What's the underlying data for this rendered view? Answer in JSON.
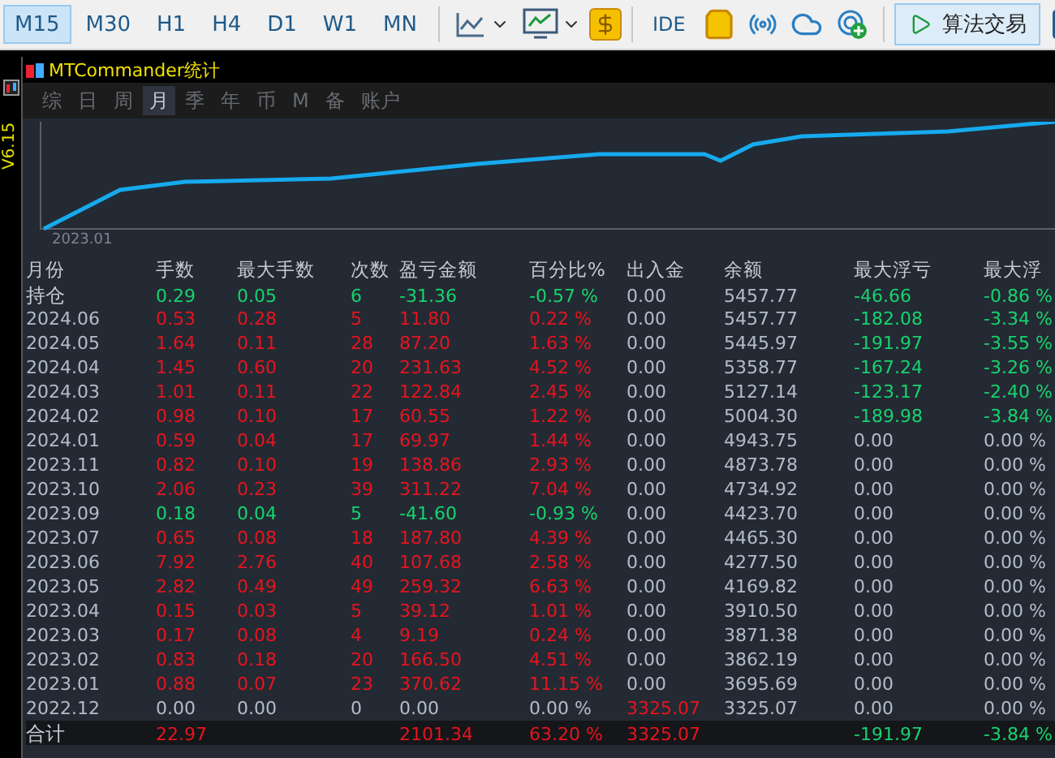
{
  "toolbar": {
    "timeframes": [
      {
        "label": "M15",
        "selected": true
      },
      {
        "label": "M30",
        "selected": false
      },
      {
        "label": "H1",
        "selected": false
      },
      {
        "label": "H4",
        "selected": false
      },
      {
        "label": "D1",
        "selected": false
      },
      {
        "label": "W1",
        "selected": false
      },
      {
        "label": "MN",
        "selected": false
      }
    ],
    "ide_label": "IDE",
    "algo_button": {
      "label": "算法交易",
      "selected": true
    }
  },
  "side_label": "V6.15",
  "panel": {
    "title": "MTCommander统计",
    "tabs": [
      {
        "label": "综",
        "selected": false
      },
      {
        "label": "日",
        "selected": false
      },
      {
        "label": "周",
        "selected": false
      },
      {
        "label": "月",
        "selected": true
      },
      {
        "label": "季",
        "selected": false
      },
      {
        "label": "年",
        "selected": false
      },
      {
        "label": "币",
        "selected": false
      },
      {
        "label": "M",
        "selected": false
      },
      {
        "label": "备",
        "selected": false
      },
      {
        "label": "账户",
        "selected": false
      }
    ],
    "chart_label": "2023.01",
    "table": {
      "columns": [
        "月份",
        "手数",
        "最大手数",
        "次数",
        "盈亏金额",
        "百分比%",
        "出入金",
        "余额",
        "最大浮亏",
        "最大浮"
      ],
      "rows": [
        {
          "kind": "open",
          "cells": [
            {
              "text": "持仓",
              "color": "#c5cad1"
            },
            {
              "text": "0.29",
              "color": "#18d26e"
            },
            {
              "text": "0.05",
              "color": "#18d26e"
            },
            {
              "text": "6",
              "color": "#18d26e"
            },
            {
              "text": "-31.36",
              "color": "#18d26e"
            },
            {
              "text": "-0.57 %",
              "color": "#18d26e"
            },
            {
              "text": "0.00",
              "color": "#b4bcc8"
            },
            {
              "text": "5457.77",
              "color": "#b4bcc8"
            },
            {
              "text": "-46.66",
              "color": "#18d26e"
            },
            {
              "text": "-0.86 %",
              "color": "#18d26e"
            }
          ]
        },
        {
          "kind": "month",
          "cells": [
            {
              "text": "2024.06",
              "color": "#b4bcc8"
            },
            {
              "text": "0.53",
              "color": "#e8141e"
            },
            {
              "text": "0.28",
              "color": "#e8141e"
            },
            {
              "text": "5",
              "color": "#e8141e"
            },
            {
              "text": "11.80",
              "color": "#e8141e"
            },
            {
              "text": "0.22 %",
              "color": "#e8141e"
            },
            {
              "text": "0.00",
              "color": "#b4bcc8"
            },
            {
              "text": "5457.77",
              "color": "#b4bcc8"
            },
            {
              "text": "-182.08",
              "color": "#18d26e"
            },
            {
              "text": "-3.34 %",
              "color": "#18d26e"
            }
          ]
        },
        {
          "kind": "month",
          "cells": [
            {
              "text": "2024.05",
              "color": "#b4bcc8"
            },
            {
              "text": "1.64",
              "color": "#e8141e"
            },
            {
              "text": "0.11",
              "color": "#e8141e"
            },
            {
              "text": "28",
              "color": "#e8141e"
            },
            {
              "text": "87.20",
              "color": "#e8141e"
            },
            {
              "text": "1.63 %",
              "color": "#e8141e"
            },
            {
              "text": "0.00",
              "color": "#b4bcc8"
            },
            {
              "text": "5445.97",
              "color": "#b4bcc8"
            },
            {
              "text": "-191.97",
              "color": "#18d26e"
            },
            {
              "text": "-3.55 %",
              "color": "#18d26e"
            }
          ]
        },
        {
          "kind": "month",
          "cells": [
            {
              "text": "2024.04",
              "color": "#b4bcc8"
            },
            {
              "text": "1.45",
              "color": "#e8141e"
            },
            {
              "text": "0.60",
              "color": "#e8141e"
            },
            {
              "text": "20",
              "color": "#e8141e"
            },
            {
              "text": "231.63",
              "color": "#e8141e"
            },
            {
              "text": "4.52 %",
              "color": "#e8141e"
            },
            {
              "text": "0.00",
              "color": "#b4bcc8"
            },
            {
              "text": "5358.77",
              "color": "#b4bcc8"
            },
            {
              "text": "-167.24",
              "color": "#18d26e"
            },
            {
              "text": "-3.26 %",
              "color": "#18d26e"
            }
          ]
        },
        {
          "kind": "month",
          "cells": [
            {
              "text": "2024.03",
              "color": "#b4bcc8"
            },
            {
              "text": "1.01",
              "color": "#e8141e"
            },
            {
              "text": "0.11",
              "color": "#e8141e"
            },
            {
              "text": "22",
              "color": "#e8141e"
            },
            {
              "text": "122.84",
              "color": "#e8141e"
            },
            {
              "text": "2.45 %",
              "color": "#e8141e"
            },
            {
              "text": "0.00",
              "color": "#b4bcc8"
            },
            {
              "text": "5127.14",
              "color": "#b4bcc8"
            },
            {
              "text": "-123.17",
              "color": "#18d26e"
            },
            {
              "text": "-2.40 %",
              "color": "#18d26e"
            }
          ]
        },
        {
          "kind": "month",
          "cells": [
            {
              "text": "2024.02",
              "color": "#b4bcc8"
            },
            {
              "text": "0.98",
              "color": "#e8141e"
            },
            {
              "text": "0.10",
              "color": "#e8141e"
            },
            {
              "text": "17",
              "color": "#e8141e"
            },
            {
              "text": "60.55",
              "color": "#e8141e"
            },
            {
              "text": "1.22 %",
              "color": "#e8141e"
            },
            {
              "text": "0.00",
              "color": "#b4bcc8"
            },
            {
              "text": "5004.30",
              "color": "#b4bcc8"
            },
            {
              "text": "-189.98",
              "color": "#18d26e"
            },
            {
              "text": "-3.84 %",
              "color": "#18d26e"
            }
          ]
        },
        {
          "kind": "month",
          "cells": [
            {
              "text": "2024.01",
              "color": "#b4bcc8"
            },
            {
              "text": "0.59",
              "color": "#e8141e"
            },
            {
              "text": "0.04",
              "color": "#e8141e"
            },
            {
              "text": "17",
              "color": "#e8141e"
            },
            {
              "text": "69.97",
              "color": "#e8141e"
            },
            {
              "text": "1.44 %",
              "color": "#e8141e"
            },
            {
              "text": "0.00",
              "color": "#b4bcc8"
            },
            {
              "text": "4943.75",
              "color": "#b4bcc8"
            },
            {
              "text": "0.00",
              "color": "#b4bcc8"
            },
            {
              "text": "0.00 %",
              "color": "#b4bcc8"
            }
          ]
        },
        {
          "kind": "month",
          "cells": [
            {
              "text": "2023.11",
              "color": "#b4bcc8"
            },
            {
              "text": "0.82",
              "color": "#e8141e"
            },
            {
              "text": "0.10",
              "color": "#e8141e"
            },
            {
              "text": "19",
              "color": "#e8141e"
            },
            {
              "text": "138.86",
              "color": "#e8141e"
            },
            {
              "text": "2.93 %",
              "color": "#e8141e"
            },
            {
              "text": "0.00",
              "color": "#b4bcc8"
            },
            {
              "text": "4873.78",
              "color": "#b4bcc8"
            },
            {
              "text": "0.00",
              "color": "#b4bcc8"
            },
            {
              "text": "0.00 %",
              "color": "#b4bcc8"
            }
          ]
        },
        {
          "kind": "month",
          "cells": [
            {
              "text": "2023.10",
              "color": "#b4bcc8"
            },
            {
              "text": "2.06",
              "color": "#e8141e"
            },
            {
              "text": "0.23",
              "color": "#e8141e"
            },
            {
              "text": "39",
              "color": "#e8141e"
            },
            {
              "text": "311.22",
              "color": "#e8141e"
            },
            {
              "text": "7.04 %",
              "color": "#e8141e"
            },
            {
              "text": "0.00",
              "color": "#b4bcc8"
            },
            {
              "text": "4734.92",
              "color": "#b4bcc8"
            },
            {
              "text": "0.00",
              "color": "#b4bcc8"
            },
            {
              "text": "0.00 %",
              "color": "#b4bcc8"
            }
          ]
        },
        {
          "kind": "month",
          "cells": [
            {
              "text": "2023.09",
              "color": "#b4bcc8"
            },
            {
              "text": "0.18",
              "color": "#18d26e"
            },
            {
              "text": "0.04",
              "color": "#18d26e"
            },
            {
              "text": "5",
              "color": "#18d26e"
            },
            {
              "text": "-41.60",
              "color": "#18d26e"
            },
            {
              "text": "-0.93 %",
              "color": "#18d26e"
            },
            {
              "text": "0.00",
              "color": "#b4bcc8"
            },
            {
              "text": "4423.70",
              "color": "#b4bcc8"
            },
            {
              "text": "0.00",
              "color": "#b4bcc8"
            },
            {
              "text": "0.00 %",
              "color": "#b4bcc8"
            }
          ]
        },
        {
          "kind": "month",
          "cells": [
            {
              "text": "2023.07",
              "color": "#b4bcc8"
            },
            {
              "text": "0.65",
              "color": "#e8141e"
            },
            {
              "text": "0.08",
              "color": "#e8141e"
            },
            {
              "text": "18",
              "color": "#e8141e"
            },
            {
              "text": "187.80",
              "color": "#e8141e"
            },
            {
              "text": "4.39 %",
              "color": "#e8141e"
            },
            {
              "text": "0.00",
              "color": "#b4bcc8"
            },
            {
              "text": "4465.30",
              "color": "#b4bcc8"
            },
            {
              "text": "0.00",
              "color": "#b4bcc8"
            },
            {
              "text": "0.00 %",
              "color": "#b4bcc8"
            }
          ]
        },
        {
          "kind": "month",
          "cells": [
            {
              "text": "2023.06",
              "color": "#b4bcc8"
            },
            {
              "text": "7.92",
              "color": "#e8141e"
            },
            {
              "text": "2.76",
              "color": "#e8141e"
            },
            {
              "text": "40",
              "color": "#e8141e"
            },
            {
              "text": "107.68",
              "color": "#e8141e"
            },
            {
              "text": "2.58 %",
              "color": "#e8141e"
            },
            {
              "text": "0.00",
              "color": "#b4bcc8"
            },
            {
              "text": "4277.50",
              "color": "#b4bcc8"
            },
            {
              "text": "0.00",
              "color": "#b4bcc8"
            },
            {
              "text": "0.00 %",
              "color": "#b4bcc8"
            }
          ]
        },
        {
          "kind": "month",
          "cells": [
            {
              "text": "2023.05",
              "color": "#b4bcc8"
            },
            {
              "text": "2.82",
              "color": "#e8141e"
            },
            {
              "text": "0.49",
              "color": "#e8141e"
            },
            {
              "text": "49",
              "color": "#e8141e"
            },
            {
              "text": "259.32",
              "color": "#e8141e"
            },
            {
              "text": "6.63 %",
              "color": "#e8141e"
            },
            {
              "text": "0.00",
              "color": "#b4bcc8"
            },
            {
              "text": "4169.82",
              "color": "#b4bcc8"
            },
            {
              "text": "0.00",
              "color": "#b4bcc8"
            },
            {
              "text": "0.00 %",
              "color": "#b4bcc8"
            }
          ]
        },
        {
          "kind": "month",
          "cells": [
            {
              "text": "2023.04",
              "color": "#b4bcc8"
            },
            {
              "text": "0.15",
              "color": "#e8141e"
            },
            {
              "text": "0.03",
              "color": "#e8141e"
            },
            {
              "text": "5",
              "color": "#e8141e"
            },
            {
              "text": "39.12",
              "color": "#e8141e"
            },
            {
              "text": "1.01 %",
              "color": "#e8141e"
            },
            {
              "text": "0.00",
              "color": "#b4bcc8"
            },
            {
              "text": "3910.50",
              "color": "#b4bcc8"
            },
            {
              "text": "0.00",
              "color": "#b4bcc8"
            },
            {
              "text": "0.00 %",
              "color": "#b4bcc8"
            }
          ]
        },
        {
          "kind": "month",
          "cells": [
            {
              "text": "2023.03",
              "color": "#b4bcc8"
            },
            {
              "text": "0.17",
              "color": "#e8141e"
            },
            {
              "text": "0.08",
              "color": "#e8141e"
            },
            {
              "text": "4",
              "color": "#e8141e"
            },
            {
              "text": "9.19",
              "color": "#e8141e"
            },
            {
              "text": "0.24 %",
              "color": "#e8141e"
            },
            {
              "text": "0.00",
              "color": "#b4bcc8"
            },
            {
              "text": "3871.38",
              "color": "#b4bcc8"
            },
            {
              "text": "0.00",
              "color": "#b4bcc8"
            },
            {
              "text": "0.00 %",
              "color": "#b4bcc8"
            }
          ]
        },
        {
          "kind": "month",
          "cells": [
            {
              "text": "2023.02",
              "color": "#b4bcc8"
            },
            {
              "text": "0.83",
              "color": "#e8141e"
            },
            {
              "text": "0.18",
              "color": "#e8141e"
            },
            {
              "text": "20",
              "color": "#e8141e"
            },
            {
              "text": "166.50",
              "color": "#e8141e"
            },
            {
              "text": "4.51 %",
              "color": "#e8141e"
            },
            {
              "text": "0.00",
              "color": "#b4bcc8"
            },
            {
              "text": "3862.19",
              "color": "#b4bcc8"
            },
            {
              "text": "0.00",
              "color": "#b4bcc8"
            },
            {
              "text": "0.00 %",
              "color": "#b4bcc8"
            }
          ]
        },
        {
          "kind": "month",
          "cells": [
            {
              "text": "2023.01",
              "color": "#b4bcc8"
            },
            {
              "text": "0.88",
              "color": "#e8141e"
            },
            {
              "text": "0.07",
              "color": "#e8141e"
            },
            {
              "text": "23",
              "color": "#e8141e"
            },
            {
              "text": "370.62",
              "color": "#e8141e"
            },
            {
              "text": "11.15 %",
              "color": "#e8141e"
            },
            {
              "text": "0.00",
              "color": "#b4bcc8"
            },
            {
              "text": "3695.69",
              "color": "#b4bcc8"
            },
            {
              "text": "0.00",
              "color": "#b4bcc8"
            },
            {
              "text": "0.00 %",
              "color": "#b4bcc8"
            }
          ]
        },
        {
          "kind": "month",
          "cells": [
            {
              "text": "2022.12",
              "color": "#b4bcc8"
            },
            {
              "text": "0.00",
              "color": "#b4bcc8"
            },
            {
              "text": "0.00",
              "color": "#b4bcc8"
            },
            {
              "text": "0",
              "color": "#b4bcc8"
            },
            {
              "text": "0.00",
              "color": "#b4bcc8"
            },
            {
              "text": "0.00 %",
              "color": "#b4bcc8"
            },
            {
              "text": "3325.07",
              "color": "#e8141e"
            },
            {
              "text": "3325.07",
              "color": "#b4bcc8"
            },
            {
              "text": "0.00",
              "color": "#b4bcc8"
            },
            {
              "text": "0.00 %",
              "color": "#b4bcc8"
            }
          ]
        },
        {
          "kind": "total",
          "cells": [
            {
              "text": "合计",
              "color": "#c5cad1"
            },
            {
              "text": "22.97",
              "color": "#e8141e"
            },
            {
              "text": ""
            },
            {
              "text": ""
            },
            {
              "text": "2101.34",
              "color": "#e8141e"
            },
            {
              "text": "63.20 %",
              "color": "#e8141e"
            },
            {
              "text": "3325.07",
              "color": "#e8141e"
            },
            {
              "text": ""
            },
            {
              "text": "-191.97",
              "color": "#18d26e"
            },
            {
              "text": "-3.84 %",
              "color": "#18d26e"
            }
          ]
        }
      ]
    }
  }
}
